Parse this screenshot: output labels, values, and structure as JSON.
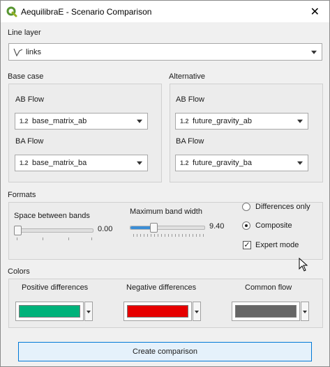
{
  "window": {
    "title": "AequilibraE - Scenario Comparison",
    "close_glyph": "✕"
  },
  "line_layer": {
    "label": "Line layer",
    "value": "links"
  },
  "base_case": {
    "title": "Base case",
    "ab_label": "AB Flow",
    "ab_value": "base_matrix_ab",
    "ba_label": "BA Flow",
    "ba_value": "base_matrix_ba"
  },
  "alternative": {
    "title": "Alternative",
    "ab_label": "AB Flow",
    "ab_value": "future_gravity_ab",
    "ba_label": "BA Flow",
    "ba_value": "future_gravity_ba"
  },
  "field_type_icon": "1.2",
  "formats": {
    "title": "Formats",
    "space_label": "Space between bands",
    "space_value": "0.00",
    "space_fraction": 0.0,
    "max_label": "Maximum band width",
    "max_value": "9.40",
    "max_fraction": 0.3,
    "option_differences": "Differences only",
    "option_composite": "Composite",
    "selected_option": "composite",
    "expert_label": "Expert mode",
    "expert_checked": true
  },
  "colors": {
    "title": "Colors",
    "positive_label": "Positive differences",
    "positive_color": "#00b27a",
    "negative_label": "Negative differences",
    "negative_color": "#e60000",
    "common_label": "Common flow",
    "common_color": "#666666"
  },
  "action": {
    "create_label": "Create comparison"
  }
}
